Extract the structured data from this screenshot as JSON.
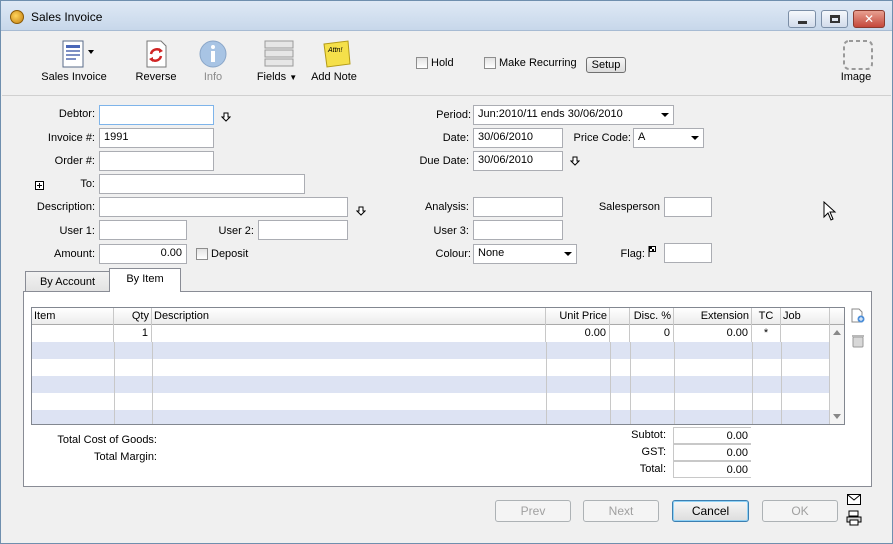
{
  "window": {
    "title": "Sales Invoice"
  },
  "toolbar": {
    "sales_invoice": "Sales Invoice",
    "reverse": "Reverse",
    "info": "Info",
    "fields": "Fields",
    "add_note": "Add Note",
    "note_text": "Attn!",
    "hold": "Hold",
    "make_recurring": "Make Recurring",
    "setup": "Setup",
    "image": "Image"
  },
  "form": {
    "debtor_label": "Debtor:",
    "debtor_value": "",
    "invoice_label": "Invoice #:",
    "invoice_value": "1991",
    "order_label": "Order #:",
    "order_value": "",
    "to_label": "To:",
    "to_value": "",
    "description_label": "Description:",
    "description_value": "",
    "user1_label": "User 1:",
    "user1_value": "",
    "user2_label": "User 2:",
    "user2_value": "",
    "amount_label": "Amount:",
    "amount_value": "0.00",
    "deposit_label": "Deposit",
    "period_label": "Period:",
    "period_value": "Jun:2010/11 ends 30/06/2010",
    "date_label": "Date:",
    "date_value": "30/06/2010",
    "price_code_label": "Price Code:",
    "price_code_value": "A",
    "due_date_label": "Due Date:",
    "due_date_value": "30/06/2010",
    "analysis_label": "Analysis:",
    "analysis_value": "",
    "salesperson_label": "Salesperson",
    "salesperson_value": "",
    "user3_label": "User 3:",
    "user3_value": "",
    "colour_label": "Colour:",
    "colour_value": "None",
    "flag_label": "Flag:",
    "flag_value": ""
  },
  "tabs": [
    {
      "label": "By Account"
    },
    {
      "label": "By Item"
    }
  ],
  "grid": {
    "headers": [
      "Item",
      "Qty",
      "Description",
      "Unit Price",
      "",
      "Disc. %",
      "Extension",
      "TC",
      "Job"
    ],
    "rows": [
      {
        "item": "",
        "qty": "1",
        "description": "",
        "unit_price": "0.00",
        "blank": "",
        "disc": "0",
        "extension": "0.00",
        "tc": "*",
        "job": ""
      }
    ]
  },
  "totals": {
    "cost_of_goods_label": "Total Cost of Goods:",
    "margin_label": "Total Margin:",
    "subtot_label": "Subtot:",
    "subtot_value": "0.00",
    "gst_label": "GST:",
    "gst_value": "0.00",
    "total_label": "Total:",
    "total_value": "0.00"
  },
  "buttons": {
    "prev": "Prev",
    "next": "Next",
    "cancel": "Cancel",
    "ok": "OK"
  },
  "colors": {
    "row_alt": "#dde3f3",
    "title_bar": "#c7d7ea",
    "close_button": "#c4483b"
  }
}
